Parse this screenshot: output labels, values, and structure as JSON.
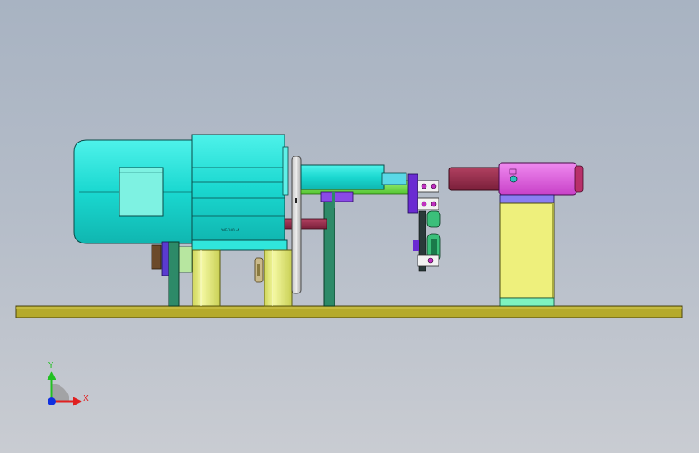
{
  "triad": {
    "x_label": "X",
    "y_label": "Y",
    "x_color": "#e02020",
    "y_color": "#22c022",
    "z_color": "#1030e0"
  },
  "motor": {
    "nameplate_text": "YVF-100L-4"
  },
  "colors": {
    "background_top": "#a8b3c2",
    "base_plate": "#b5aa2c",
    "motor_body": "#1ee0d8",
    "frame_green": "#2d8a68",
    "pillar_yellow": "#e9f07a",
    "shaft_green": "#7ee04a",
    "flywheel_gray": "#d7d7d7",
    "maroon_rod": "#8a2a46",
    "purple_bracket": "#6a2bd2",
    "pink_cylinder": "#e060e0",
    "yellow_housing": "#eef07c"
  }
}
